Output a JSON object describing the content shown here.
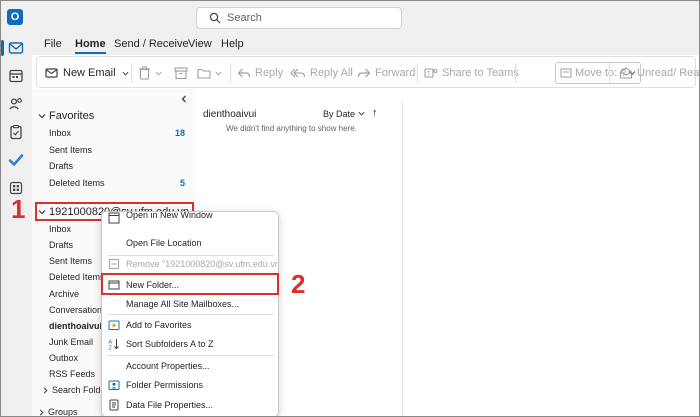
{
  "app": {
    "logo_letter": "O"
  },
  "search": {
    "placeholder": "Search"
  },
  "menu": {
    "tabs": [
      "File",
      "Home",
      "Send / Receive",
      "View",
      "Help"
    ],
    "active": "Home"
  },
  "ribbon": {
    "new_email": "New Email",
    "reply": "Reply",
    "reply_all": "Reply All",
    "forward": "Forward",
    "share_to_teams": "Share to Teams",
    "move_to": "Move to: ?",
    "unread_read": "Unread/ Read"
  },
  "folders": {
    "favorites_label": "Favorites",
    "favorites": [
      {
        "label": "Inbox",
        "count": "18"
      },
      {
        "label": "Sent Items",
        "count": ""
      },
      {
        "label": "Drafts",
        "count": ""
      },
      {
        "label": "Deleted Items",
        "count": "5"
      }
    ],
    "account": "1921000820@sv.ufm.edu.vn",
    "account_folders": [
      "Inbox",
      "Drafts",
      "Sent Items",
      "Deleted Items",
      "Archive",
      "Conversation H",
      "dienthoaivui",
      "Junk Email",
      "Outbox",
      "RSS Feeds",
      "Search Folders"
    ],
    "selected_folder": "dienthoaivui",
    "groups": "Groups"
  },
  "message_list": {
    "folder_title": "dienthoaivui",
    "sort": "By Date",
    "sort_direction": "↑",
    "empty": "We didn't find anything to show here."
  },
  "context_menu": {
    "open_new_window": "Open in New Window",
    "open_file_location": "Open File Location",
    "remove": "Remove \"1921000820@sv.ufm.edu.vn\"",
    "new_folder": "New Folder...",
    "manage_mailboxes": "Manage All Site Mailboxes...",
    "add_favorites": "Add to Favorites",
    "sort_subfolders": "Sort Subfolders A to Z",
    "account_properties": "Account Properties...",
    "folder_permissions": "Folder Permissions",
    "data_file_properties": "Data File Properties..."
  },
  "annotations": {
    "step1": "1",
    "step2": "2"
  },
  "colors": {
    "accent": "#0f6cbd",
    "annotation": "#d9302c"
  }
}
